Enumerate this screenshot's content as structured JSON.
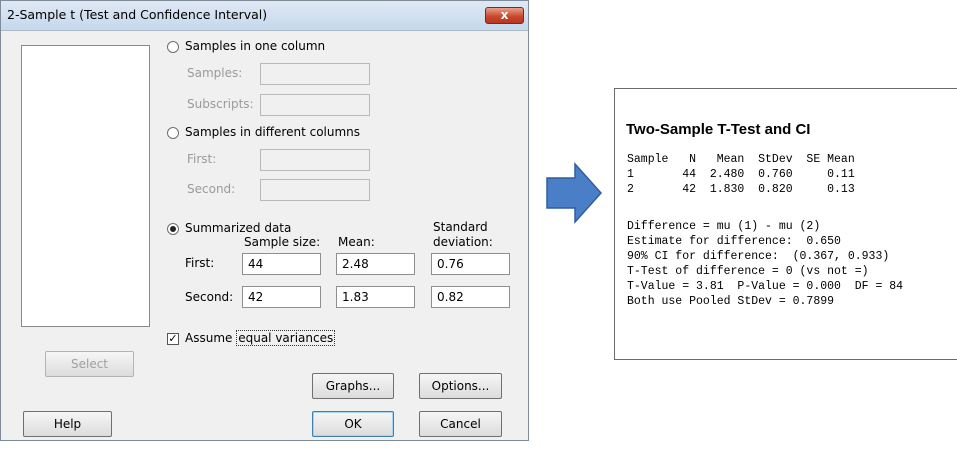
{
  "dialog": {
    "title": "2-Sample t (Test and Confidence Interval)",
    "close_label": "x",
    "one_column": {
      "label": "Samples in one column",
      "samples_label": "Samples:",
      "subscripts_label": "Subscripts:",
      "samples_value": "",
      "subscripts_value": ""
    },
    "different_columns": {
      "label": "Samples in different columns",
      "first_label": "First:",
      "second_label": "Second:",
      "first_value": "",
      "second_value": ""
    },
    "summarized": {
      "label": "Summarized data",
      "col_sample_size": "Sample size:",
      "col_mean": "Mean:",
      "col_sd_line1": "Standard",
      "col_sd_line2": "deviation:",
      "first_label": "First:",
      "second_label": "Second:",
      "first": {
        "sample_size": "44",
        "mean": "2.48",
        "sd": "0.76"
      },
      "second": {
        "sample_size": "42",
        "mean": "1.83",
        "sd": "0.82"
      }
    },
    "assume_equal": {
      "prefix": "Assume ",
      "focused": "equal variances",
      "checked": true
    },
    "buttons": {
      "select": "Select",
      "graphs": "Graphs...",
      "options": "Options...",
      "help": "Help",
      "ok": "OK",
      "cancel": "Cancel"
    }
  },
  "arrow": {
    "icon": "right-arrow-icon",
    "color": "#4a7fc8"
  },
  "output": {
    "title": "Two-Sample T-Test and CI",
    "lines": [
      "Sample   N   Mean  StDev  SE Mean",
      "1       44  2.480  0.760     0.11",
      "2       42  1.830  0.820     0.13",
      "",
      "Difference = mu (1) - mu (2)",
      "Estimate for difference:  0.650",
      "90% CI for difference:  (0.367, 0.933)",
      "T-Test of difference = 0 (vs not =)",
      "T-Value = 3.81  P-Value = 0.000  DF = 84",
      "Both use Pooled StDev = 0.7899"
    ]
  }
}
